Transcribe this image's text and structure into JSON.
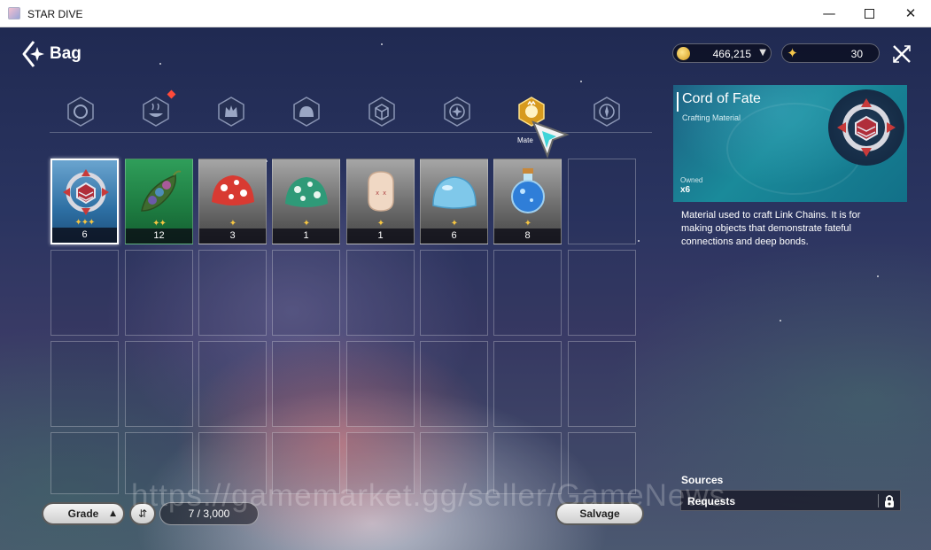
{
  "window": {
    "title": "STAR DIVE",
    "minimize": "—",
    "close": "✕"
  },
  "header": {
    "title": "Bag",
    "back_icon": "back-arrow-icon",
    "close_icon": "crossed-swords-close-icon"
  },
  "currencies": [
    {
      "name": "gold",
      "icon": "gold-coin-icon",
      "value": "466,215",
      "dropdown": "▼"
    },
    {
      "name": "star",
      "icon": "star-icon",
      "value": "30"
    }
  ],
  "tabs": [
    {
      "icon": "pet-tab-icon",
      "active": false
    },
    {
      "icon": "food-tab-icon",
      "active": false,
      "badge": true
    },
    {
      "icon": "monster-tab-icon",
      "active": false
    },
    {
      "icon": "slime-tab-icon",
      "active": false
    },
    {
      "icon": "box-tab-icon",
      "active": false
    },
    {
      "icon": "star-tab-icon",
      "active": false
    },
    {
      "icon": "material-tab-icon",
      "active": true,
      "label": "Mate"
    },
    {
      "icon": "compass-tab-icon",
      "active": false
    }
  ],
  "items": [
    {
      "name": "cord-of-fate",
      "stars": "✦✦✦",
      "qty": "6",
      "rarity": "blue",
      "selected": true
    },
    {
      "name": "rainbow-pea-pod",
      "stars": "✦✦",
      "qty": "12",
      "rarity": "green"
    },
    {
      "name": "red-mushroom",
      "stars": "✦",
      "qty": "3",
      "rarity": "gray"
    },
    {
      "name": "green-mushroom",
      "stars": "✦",
      "qty": "1",
      "rarity": "gray"
    },
    {
      "name": "mandrake-root",
      "stars": "✦",
      "qty": "1",
      "rarity": "gray"
    },
    {
      "name": "blue-slime-jelly",
      "stars": "✦",
      "qty": "6",
      "rarity": "gray"
    },
    {
      "name": "blue-potion",
      "stars": "✦",
      "qty": "8",
      "rarity": "gray"
    }
  ],
  "controls": {
    "grade_label": "Grade",
    "grade_arrow": "▲",
    "sort_icon": "sort-order-icon",
    "sort_glyph": "⇵",
    "capacity": "7 / 3,000",
    "salvage_label": "Salvage"
  },
  "detail": {
    "name": "Cord of Fate",
    "type": "Crafting Material",
    "owned_label": "Owned",
    "owned_value": "x6",
    "description": "Material used to craft Link Chains. It is for making objects that demonstrate fateful connections and deep bonds.",
    "sources_label": "Sources",
    "source_item": "Requests",
    "lock_icon": "lock-icon"
  },
  "watermark": "https://gamemarket.gg/seller/GameNews"
}
